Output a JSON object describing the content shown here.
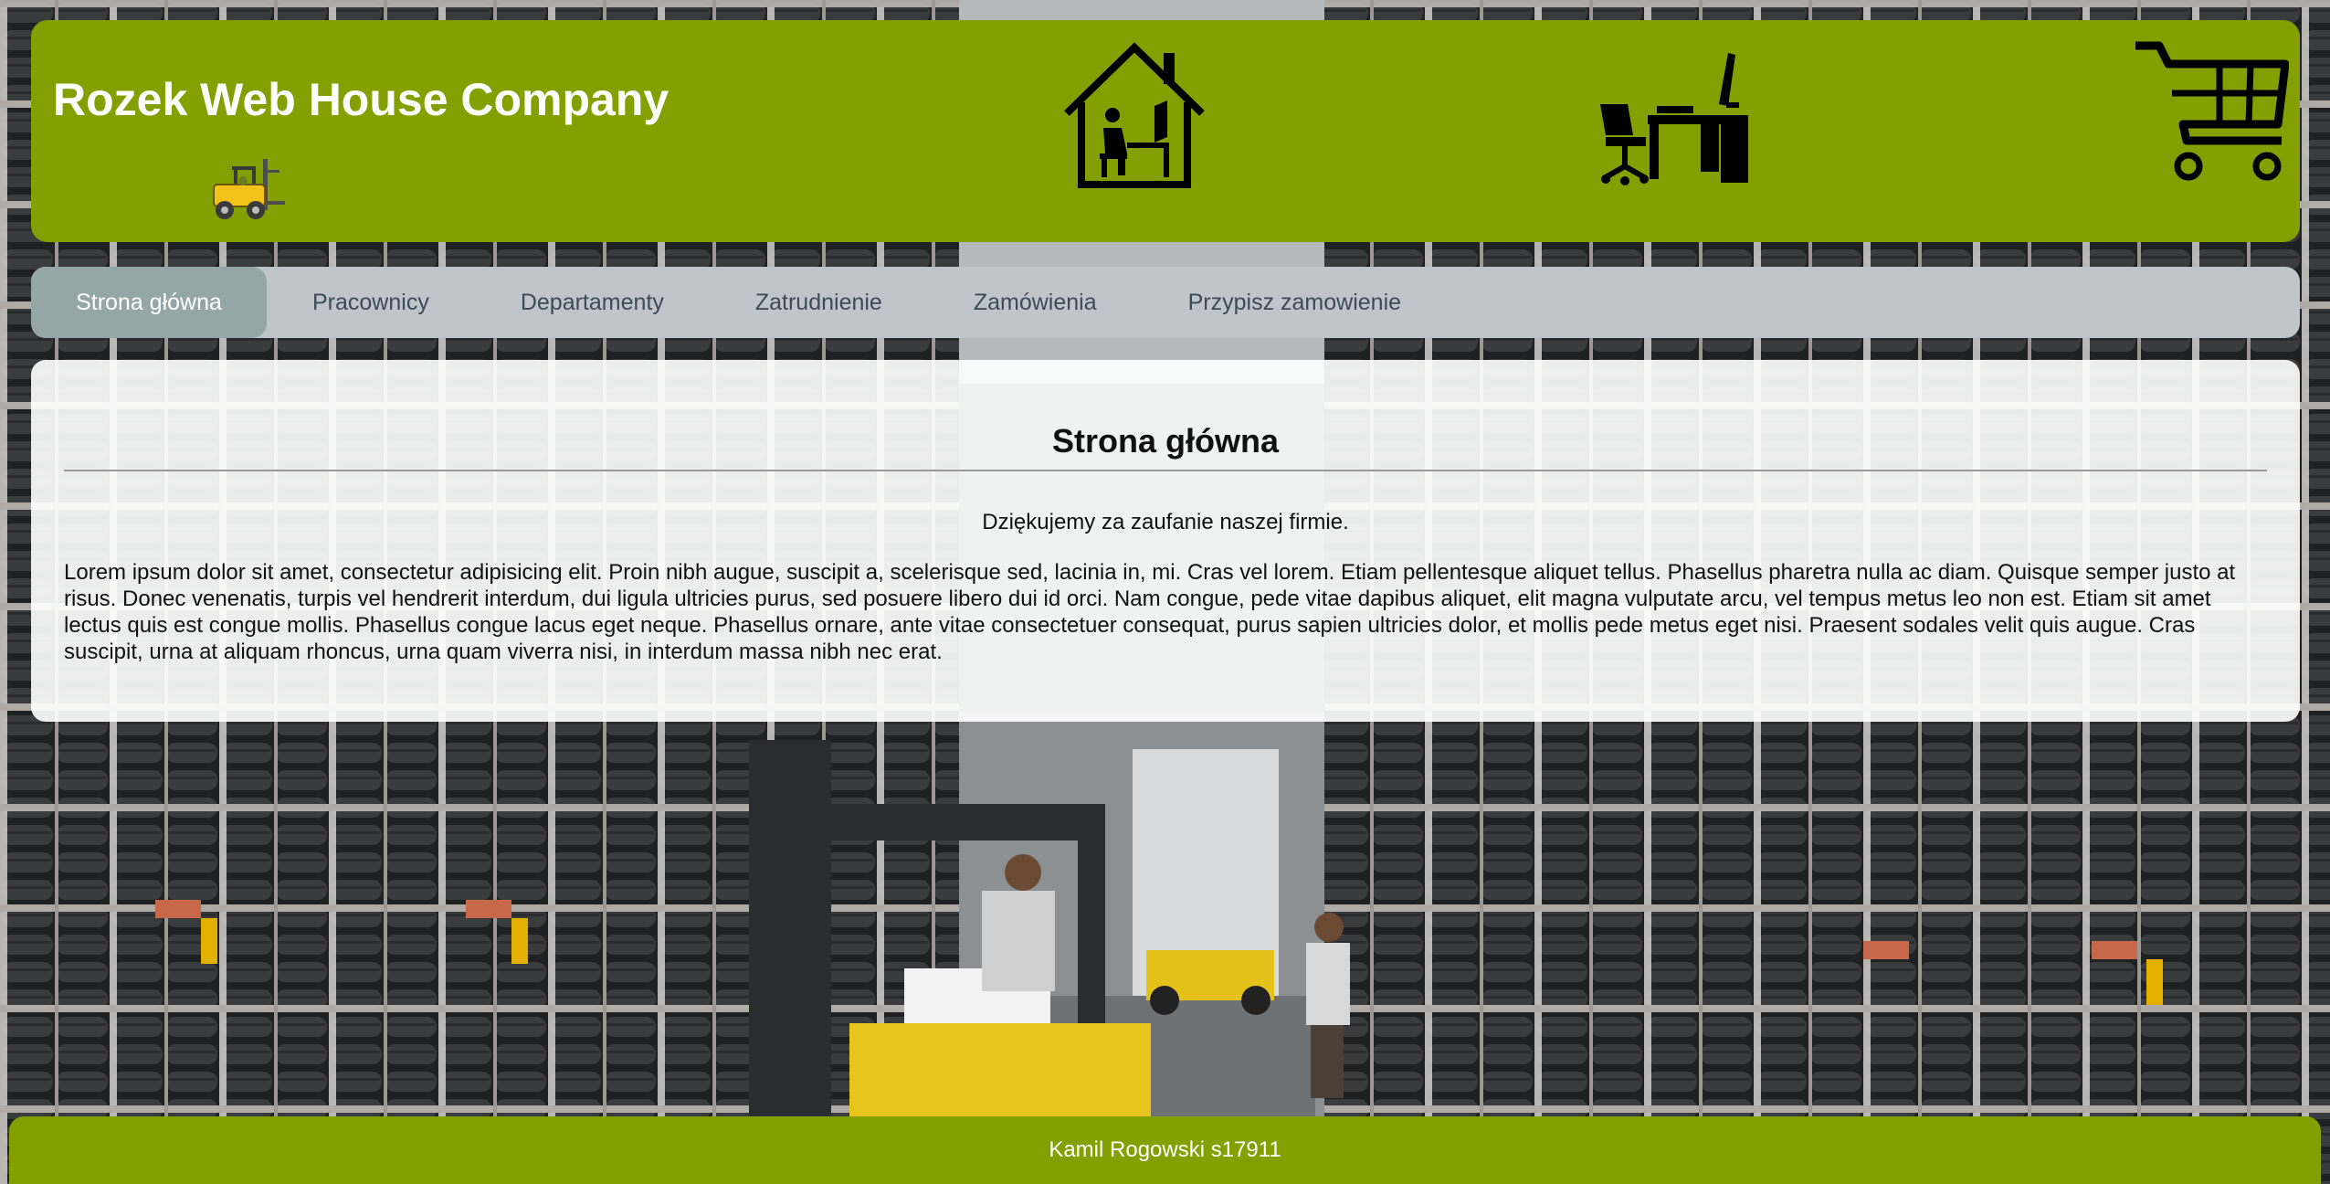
{
  "header": {
    "title": "Rozek Web House Company",
    "logo_icon": "forklift-icon",
    "icons": [
      "home-office-icon",
      "computer-desk-icon",
      "shopping-cart-icon"
    ]
  },
  "nav": {
    "items": [
      {
        "label": "Strona główna",
        "active": true
      },
      {
        "label": "Pracownicy"
      },
      {
        "label": "Departamenty"
      },
      {
        "label": "Zatrudnienie"
      },
      {
        "label": "Zamówienia"
      },
      {
        "label": "Przypisz zamowienie"
      }
    ]
  },
  "main": {
    "heading": "Strona główna",
    "thanks": "Dziękujemy za zaufanie naszej firmie.",
    "body": "Lorem ipsum dolor sit amet, consectetur adipisicing elit. Proin nibh augue, suscipit a, scelerisque sed, lacinia in, mi. Cras vel lorem. Etiam pellentesque aliquet tellus. Phasellus pharetra nulla ac diam. Quisque semper justo at risus. Donec venenatis, turpis vel hendrerit interdum, dui ligula ultricies purus, sed posuere libero dui id orci. Nam congue, pede vitae dapibus aliquet, elit magna vulputate arcu, vel tempus metus leo non est. Etiam sit amet lectus quis est congue mollis. Phasellus congue lacus eget neque. Phasellus ornare, ante vitae consectetuer consequat, purus sapien ultricies dolor, et mollis pede metus eget nisi. Praesent sodales velit quis augue. Cras suscipit, urna at aliquam rhoncus, urna quam viverra nisi, in interdum massa nibh nec erat."
  },
  "footer": {
    "text": "Kamil Rogowski s17911"
  },
  "colors": {
    "header_green": "#84a000",
    "nav_bg": "#bfc5ca",
    "nav_active": "#95a6a7",
    "nav_text": "#3d4a57"
  },
  "background": "warehouse-tire-racks-forklift-photo"
}
